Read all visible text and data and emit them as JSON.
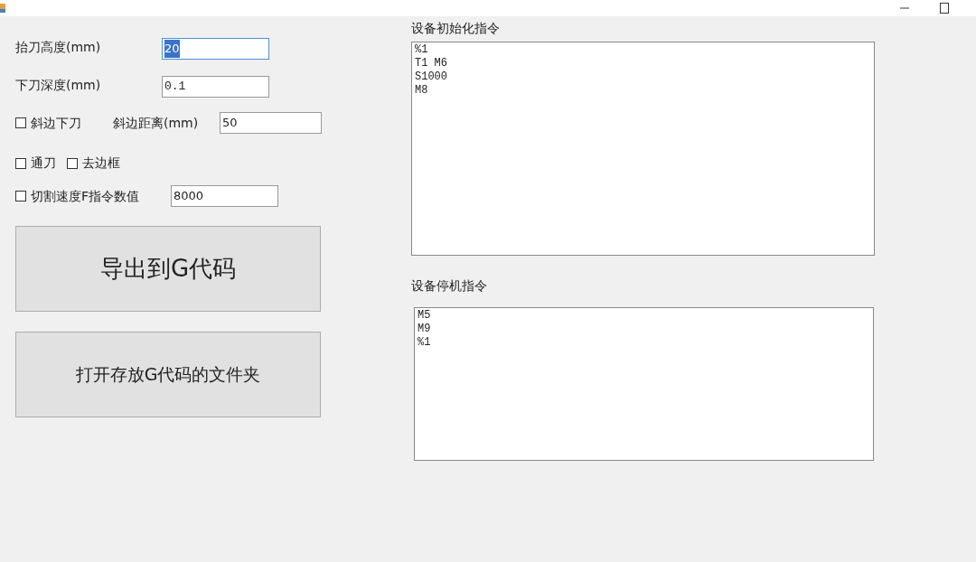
{
  "window": {
    "controls": [
      {
        "kind": "minimize"
      },
      {
        "kind": "maximize"
      }
    ]
  },
  "fields": [
    {
      "label": "抬刀高度(mm)",
      "value": "20",
      "text_selected": true
    },
    {
      "label": "下刀深度(mm)",
      "value": "0.1",
      "text_selected": false
    }
  ],
  "bevel": {
    "checkbox": {
      "label": "斜边下刀",
      "checked": false
    },
    "label": "斜边距离(mm)",
    "value": "50"
  },
  "options": [
    {
      "label": "通刀",
      "checked": false
    },
    {
      "label": "去边框",
      "checked": false
    }
  ],
  "speed": {
    "checkbox": {
      "label": "切割速度F指令数值",
      "checked": false
    },
    "value": "8000"
  },
  "buttons": [
    {
      "label": "导出到G代码",
      "kind": "large"
    },
    {
      "label": "打开存放G代码的文件夹",
      "kind": "normal"
    }
  ],
  "init_commands": {
    "label": "设备初始化指令",
    "lines": [
      "%1",
      "T1 M6",
      "S1000",
      "M8"
    ]
  },
  "stop_commands": {
    "label": "设备停机指令",
    "lines": [
      "M5",
      "M9",
      "%1"
    ]
  }
}
